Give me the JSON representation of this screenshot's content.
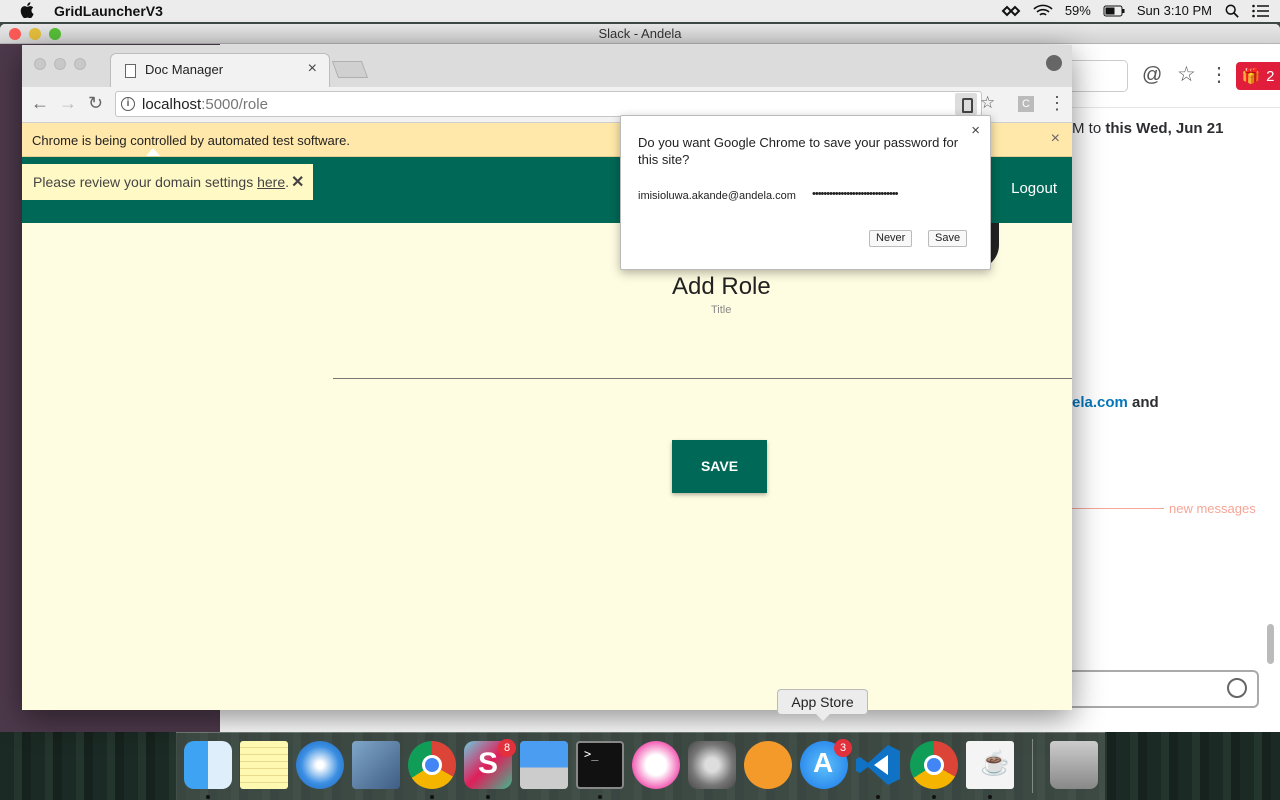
{
  "menubar": {
    "app_name": "GridLauncherV3",
    "battery": "59%",
    "clock": "Sun 3:10 PM"
  },
  "slack": {
    "window_title": "Slack - Andela",
    "gift_count": "2",
    "message_fragment_1_prefix": "M to ",
    "message_fragment_1_bold": "this Wed, Jun 21",
    "message_fragment_2_link": "ela.com",
    "message_fragment_2_suffix": " and",
    "new_messages_label": "new messages"
  },
  "chrome": {
    "tab_title": "Doc Manager",
    "url_host": "localhost",
    "url_path": ":5000/role",
    "ext_label": "C",
    "infobar_text": "Chrome is being controlled by automated test software."
  },
  "app": {
    "logout_label": "Logout",
    "domain_toast_prefix": "Please review your domain settings ",
    "domain_toast_link": "here",
    "domain_toast_suffix": ".",
    "page_title": "Add Role",
    "title_field_label": "Title",
    "save_button_label": "SAVE"
  },
  "password_prompt": {
    "question": "Do you want Google Chrome to save your password for this site?",
    "username": "imisioluwa.akande@andela.com",
    "password_mask": "••••••••••••••••••••••••••••••",
    "never_label": "Never",
    "save_label": "Save"
  },
  "dock": {
    "tooltip": "App Store",
    "slack_badge": "8",
    "appstore_badge": "3",
    "icons": [
      "finder-icon",
      "notes-icon",
      "safari-icon",
      "mail-icon",
      "chrome-icon",
      "slack-icon",
      "keynote-icon",
      "terminal-icon",
      "itunes-icon",
      "system-preferences-icon",
      "ibooks-icon",
      "app-store-icon",
      "vscode-icon",
      "chrome-icon",
      "java-icon",
      "trash-icon"
    ]
  },
  "colors": {
    "app_primary": "#006856",
    "app_background": "#fffde1",
    "infobar": "#ffe8a9",
    "slack_sidebar": "#4d394b"
  }
}
